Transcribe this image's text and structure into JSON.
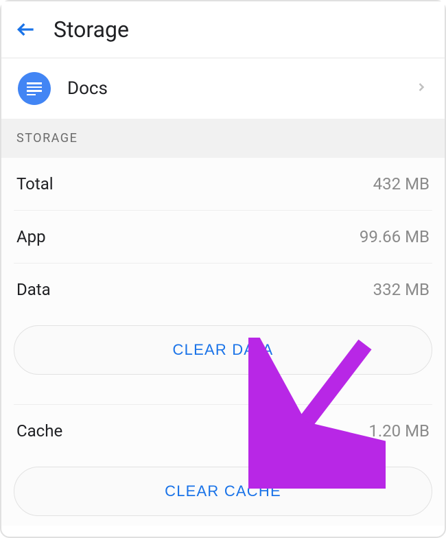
{
  "header": {
    "title": "Storage"
  },
  "app": {
    "name": "Docs"
  },
  "section_label": "STORAGE",
  "stats": {
    "total": {
      "label": "Total",
      "value": "432 MB"
    },
    "app": {
      "label": "App",
      "value": "99.66 MB"
    },
    "data": {
      "label": "Data",
      "value": "332 MB"
    },
    "cache": {
      "label": "Cache",
      "value": "1.20 MB"
    }
  },
  "buttons": {
    "clear_data": "CLEAR DATA",
    "clear_cache": "CLEAR CACHE"
  },
  "colors": {
    "accent": "#1a73e8",
    "app_icon_bg": "#4285f4",
    "annotation": "#b827e6"
  }
}
